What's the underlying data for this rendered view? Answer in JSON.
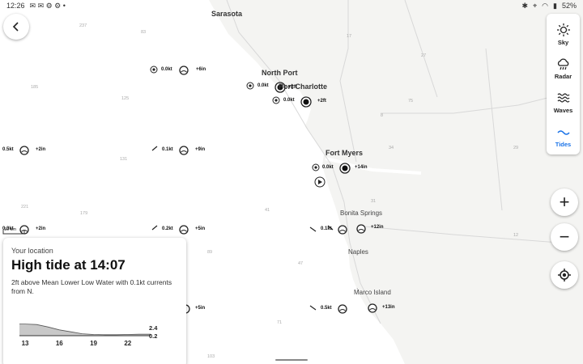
{
  "status": {
    "time": "12:26",
    "battery": "52%"
  },
  "back_icon": "chevron-left-icon",
  "layers": [
    {
      "label": "Sky",
      "icon": "sun-icon",
      "active": false
    },
    {
      "label": "Radar",
      "icon": "radar-cloud-icon",
      "active": false
    },
    {
      "label": "Waves",
      "icon": "waves-icon",
      "active": false
    },
    {
      "label": "Tides",
      "icon": "tides-icon",
      "active": true
    }
  ],
  "controls": {
    "zoom_in": "+",
    "zoom_out": "−",
    "locate_icon": "locate-icon"
  },
  "places": [
    "Sarasota",
    "North Port",
    "Port Charlotte",
    "Fort Myers",
    "Bonita Springs",
    "Naples",
    "Marco Island"
  ],
  "depths": [
    "237",
    "83",
    "185",
    "125",
    "131",
    "221",
    "179",
    "89",
    "41",
    "47",
    "71",
    "103",
    "17",
    "75",
    "8",
    "34",
    "29",
    "31",
    "27",
    "12",
    "1"
  ],
  "markers": [
    {
      "current": "0.0kt",
      "tide": "+6in"
    },
    {
      "current": "0.0kt",
      "tide": "+2ft"
    },
    {
      "current": "0.0kt",
      "tide": "+2ft"
    },
    {
      "current": "0.5kt",
      "tide": "+2in"
    },
    {
      "current": "0.1kt",
      "tide": "+9in"
    },
    {
      "current": "0.0kt",
      "tide": "+14in"
    },
    {
      "current": "0.2kt",
      "tide": "+5in"
    },
    {
      "current": "0.0kt",
      "tide": "+2in"
    },
    {
      "current": "0.1kt",
      "tide": "+12in"
    },
    {
      "current": "0.5kt",
      "tide": "+13in"
    },
    {
      "current": "",
      "tide": "+5in"
    }
  ],
  "scale_label": "10 km",
  "card": {
    "subtitle": "Your location",
    "title": "High tide at 14:07",
    "description": "2ft above Mean Lower Low Water with 0.1kt currents from N."
  },
  "chart_data": {
    "type": "area",
    "x": [
      12.5,
      13,
      14,
      15,
      16,
      17,
      18,
      19,
      20,
      21,
      22,
      23,
      24
    ],
    "values": [
      2.4,
      2.4,
      2.3,
      1.8,
      1.2,
      0.8,
      0.4,
      0.25,
      0.2,
      0.2,
      0.25,
      0.3,
      0.3
    ],
    "xticks": [
      "13",
      "16",
      "19",
      "22"
    ],
    "xtick_values": [
      13,
      16,
      19,
      22
    ],
    "yticks": [
      "2.4",
      "0.2"
    ],
    "ylim": [
      0,
      3
    ]
  }
}
